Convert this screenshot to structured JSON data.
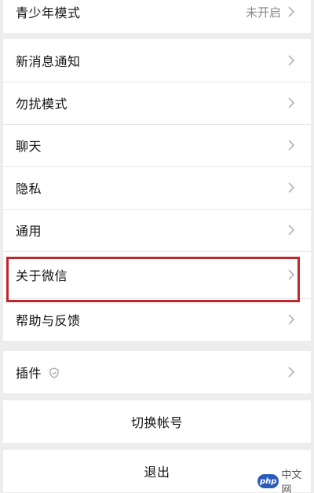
{
  "settings": {
    "group1": {
      "items": [
        {
          "label": "青少年模式",
          "value": "未开启"
        }
      ]
    },
    "group2": {
      "items": [
        {
          "label": "新消息通知"
        },
        {
          "label": "勿扰模式"
        },
        {
          "label": "聊天"
        },
        {
          "label": "隐私"
        },
        {
          "label": "通用"
        },
        {
          "label": "关于微信"
        },
        {
          "label": "帮助与反馈"
        }
      ]
    },
    "group3": {
      "items": [
        {
          "label": "插件",
          "icon": "shield-icon"
        }
      ]
    },
    "switch_account_label": "切换帐号",
    "logout_label": "退出"
  },
  "watermark": {
    "logo_text": "php",
    "site_text": "中文网"
  },
  "colors": {
    "background": "#ededed",
    "card": "#ffffff",
    "highlight": "#c0262e"
  }
}
